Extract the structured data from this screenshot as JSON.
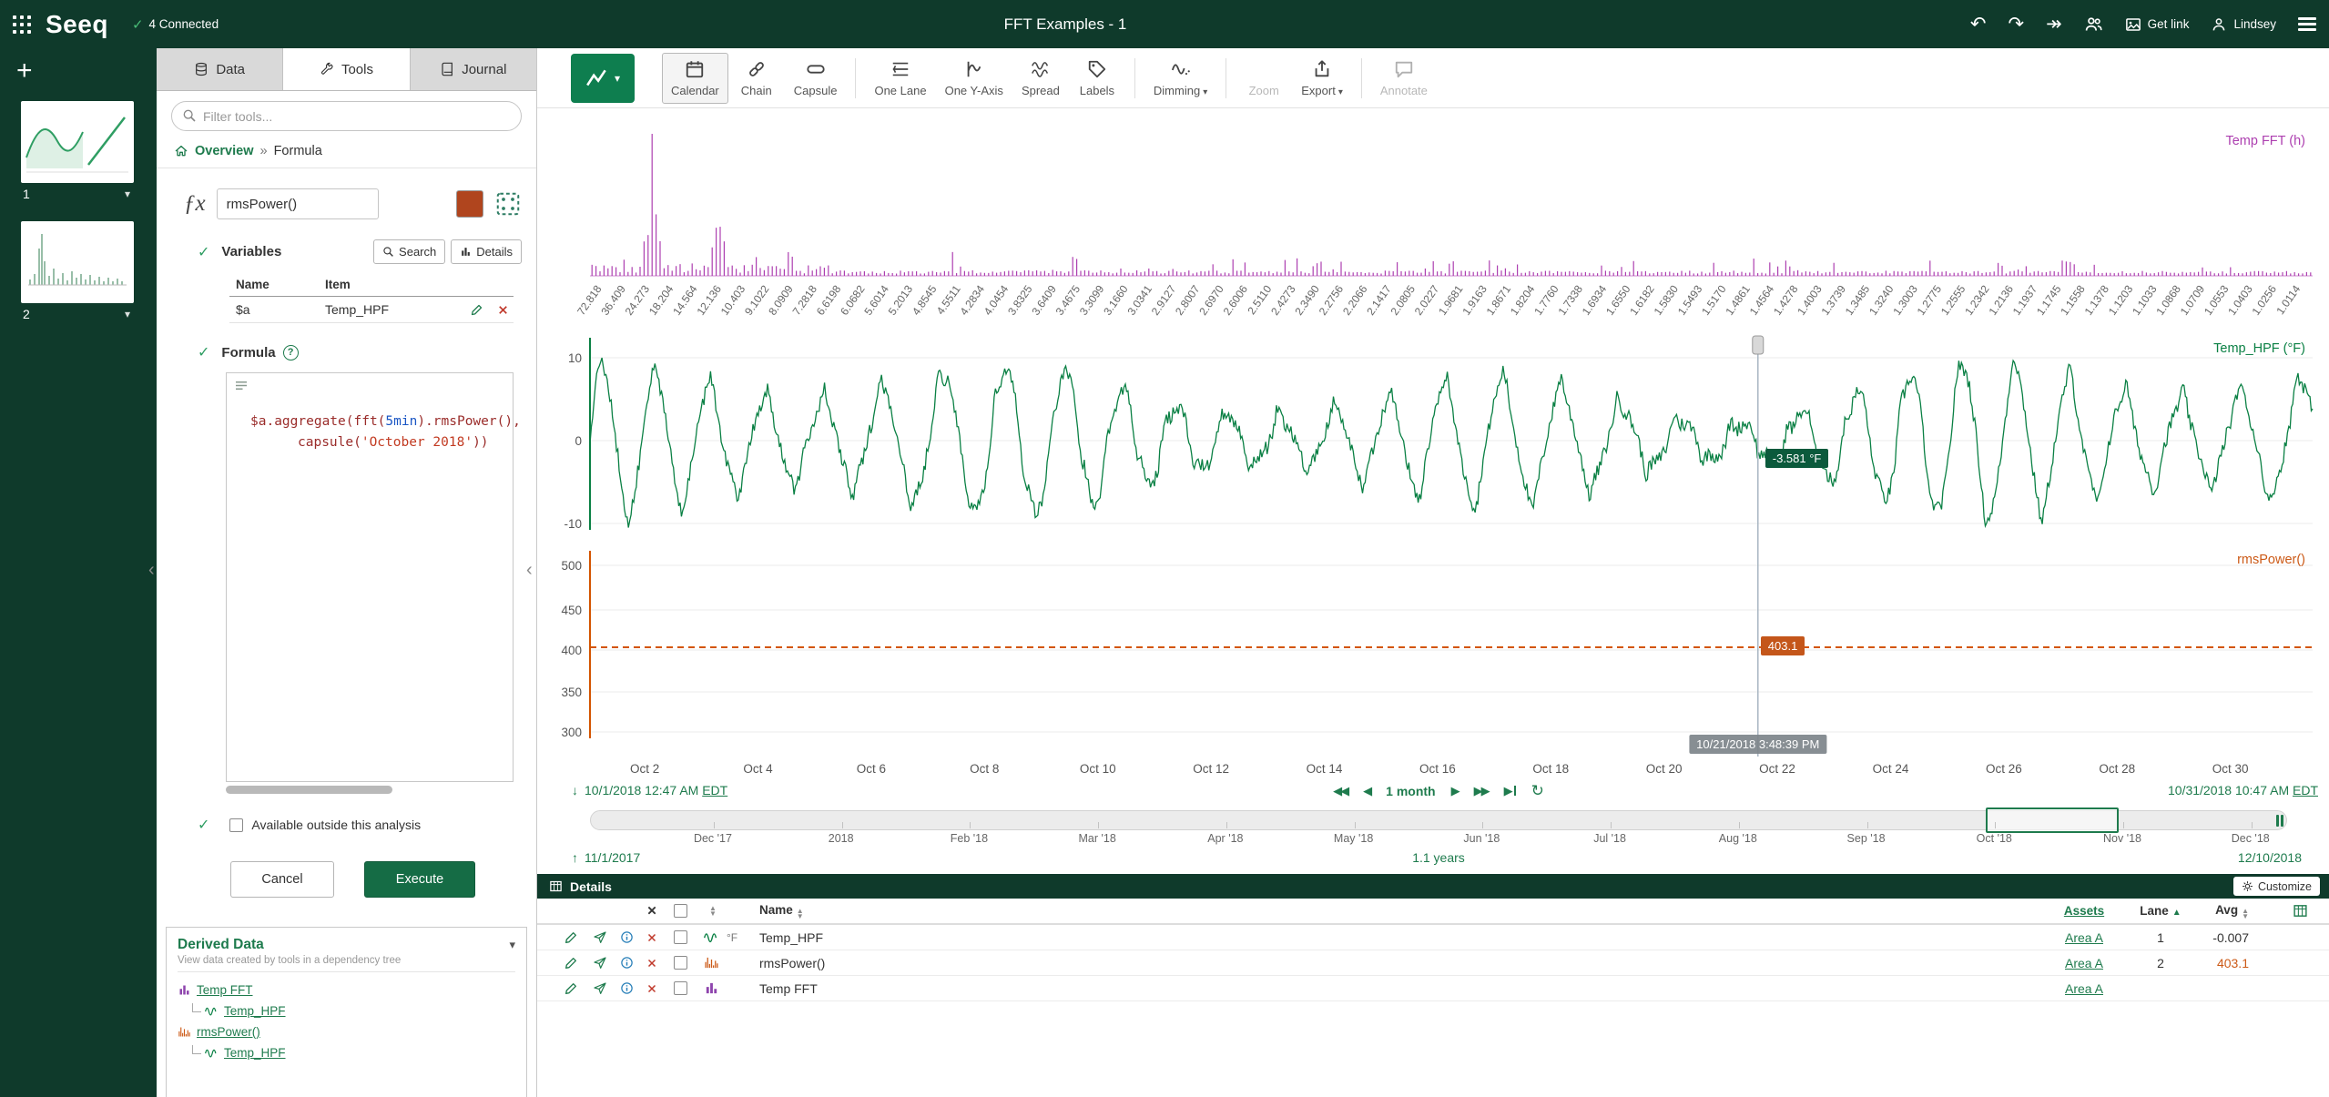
{
  "topbar": {
    "logo": "Seeq",
    "connected": "4 Connected",
    "title": "FFT Examples - 1",
    "get_link": "Get link",
    "user": "Lindsey"
  },
  "sidebar": {
    "sheets": [
      {
        "num": "1"
      },
      {
        "num": "2"
      }
    ]
  },
  "tools": {
    "tabs": [
      {
        "label": "Data"
      },
      {
        "label": "Tools"
      },
      {
        "label": "Journal"
      }
    ],
    "filter_placeholder": "Filter tools...",
    "breadcrumb_root": "Overview",
    "breadcrumb_sep": "»",
    "breadcrumb_current": "Formula",
    "formula": {
      "fx": "ƒx",
      "name": "rmsPower()",
      "swatch_color": "#b0451e",
      "variables_label": "Variables",
      "search_btn": "Search",
      "details_btn": "Details",
      "col_name": "Name",
      "col_item": "Item",
      "vars": [
        {
          "name": "$a",
          "item": "Temp_HPF"
        }
      ],
      "formula_label": "Formula",
      "help": "?",
      "code_lines": [
        [
          {
            "t": "$a.aggregate(fft(",
            "c": "k"
          },
          {
            "t": "5min",
            "c": "n"
          },
          {
            "t": ").rmsPower(),",
            "c": "k"
          }
        ],
        [
          {
            "t": "capsule(",
            "c": "k"
          },
          {
            "t": "'October 2018'",
            "c": "s"
          },
          {
            "t": "))",
            "c": "k"
          }
        ]
      ],
      "available_label": "Available outside this analysis",
      "cancel": "Cancel",
      "execute": "Execute"
    },
    "derived": {
      "title": "Derived Data",
      "subtitle": "View data created by tools in a dependency tree",
      "items": [
        {
          "label": "Temp FFT",
          "icon": "bars",
          "color": "#8e44ad",
          "child": false
        },
        {
          "label": "Temp_HPF",
          "icon": "wave",
          "color": "#0a8044",
          "child": true
        },
        {
          "label": "rmsPower()",
          "icon": "spikes",
          "color": "#cc5a17",
          "child": false
        },
        {
          "label": "Temp_HPF",
          "icon": "wave",
          "color": "#0a8044",
          "child": true
        }
      ]
    }
  },
  "toolbar": {
    "buttons": [
      {
        "label": "Calendar",
        "icon": "calendar",
        "active": true
      },
      {
        "label": "Chain",
        "icon": "chain"
      },
      {
        "label": "Capsule",
        "icon": "capsule",
        "sep_after": true
      },
      {
        "label": "One Lane",
        "icon": "lane"
      },
      {
        "label": "One Y-Axis",
        "icon": "yaxis"
      },
      {
        "label": "Spread",
        "icon": "spread"
      },
      {
        "label": "Labels",
        "icon": "tag",
        "sep_after": true
      },
      {
        "label": "Dimming",
        "icon": "dim",
        "caret": true,
        "sep_after": true
      },
      {
        "label": "Zoom",
        "icon": "zoom",
        "disabled": true
      },
      {
        "label": "Export",
        "icon": "export",
        "caret": true,
        "sep_after": true
      },
      {
        "label": "Annotate",
        "icon": "annotate",
        "disabled": true
      }
    ]
  },
  "chart": {
    "fft_label": "Temp FFT (h)",
    "hpf_label": "Temp_HPF (°F)",
    "rms_label": "rmsPower()",
    "hpf_ticks": [
      "10",
      "0",
      "-10"
    ],
    "rms_ticks": [
      "500",
      "450",
      "400",
      "350",
      "300"
    ],
    "fft_ticks": [
      "72.818",
      "36.409",
      "24.273",
      "18.204",
      "14.564",
      "12.136",
      "10.403",
      "9.1022",
      "8.0909",
      "7.2818",
      "6.6198",
      "6.0682",
      "5.6014",
      "5.2013",
      "4.8545",
      "4.5511",
      "4.2834",
      "4.0454",
      "3.8325",
      "3.6409",
      "3.4675",
      "3.3099",
      "3.1660",
      "3.0341",
      "2.9127",
      "2.8007",
      "2.6970",
      "2.6006",
      "2.5110",
      "2.4273",
      "2.3490",
      "2.2756",
      "2.2066",
      "2.1417",
      "2.0805",
      "2.0227",
      "1.9681",
      "1.9163",
      "1.8671",
      "1.8204",
      "1.7760",
      "1.7338",
      "1.6934",
      "1.6550",
      "1.6182",
      "1.5830",
      "1.5493",
      "1.5170",
      "1.4861",
      "1.4564",
      "1.4278",
      "1.4003",
      "1.3739",
      "1.3485",
      "1.3240",
      "1.3003",
      "1.2775",
      "1.2555",
      "1.2342",
      "1.2136",
      "1.1937",
      "1.1745",
      "1.1558",
      "1.1378",
      "1.1203",
      "1.1033",
      "1.0868",
      "1.0709",
      "1.0553",
      "1.0403",
      "1.0256",
      "1.0114"
    ],
    "x_ticks": [
      "Oct 2",
      "Oct 4",
      "Oct 6",
      "Oct 8",
      "Oct 10",
      "Oct 12",
      "Oct 14",
      "Oct 16",
      "Oct 18",
      "Oct 20",
      "Oct 22",
      "Oct 24",
      "Oct 26",
      "Oct 28",
      "Oct 30"
    ],
    "cursor_time": "10/21/2018 3:48:39 PM",
    "cursor_temp": "-3.581 °F",
    "cursor_rms": "403.1",
    "cursor_frac": 0.678,
    "range_start": "10/1/2018 12:47 AM",
    "range_start_tz": "EDT",
    "range_end": "10/31/2018 10:47 AM",
    "range_end_tz": "EDT",
    "step_label": "1 month",
    "timeline_ticks": [
      "Dec '17",
      "2018",
      "Feb '18",
      "Mar '18",
      "Apr '18",
      "May '18",
      "Jun '18",
      "Jul '18",
      "Aug '18",
      "Sep '18",
      "Oct '18",
      "Nov '18",
      "Dec '18"
    ],
    "timeline_start": "11/1/2017",
    "timeline_duration": "1.1 years",
    "timeline_end": "12/10/2018",
    "sel_frac": [
      0.823,
      0.901
    ],
    "colors": {
      "fft": "#ad3fb0",
      "hpf": "#0a8044",
      "rms": "#d35400"
    }
  },
  "details": {
    "title": "Details",
    "customize": "Customize",
    "x_header": "✕",
    "name_header": "Name",
    "assets_header": "Assets",
    "lane_header": "Lane",
    "avg_header": "Avg",
    "rows": [
      {
        "icon": "wave",
        "color": "#0a8044",
        "unit": "°F",
        "name": "Temp_HPF",
        "asset": "Area A",
        "lane": "1",
        "avg": "-0.007",
        "avg_color": "#333333"
      },
      {
        "icon": "spikes",
        "color": "#cc5a17",
        "unit": "",
        "name": "rmsPower()",
        "asset": "Area A",
        "lane": "2",
        "avg": "403.1",
        "avg_color": "#cc5a17"
      },
      {
        "icon": "bars",
        "color": "#8e44ad",
        "unit": "",
        "name": "Temp FFT",
        "asset": "Area A",
        "lane": "",
        "avg": "",
        "avg_color": "#333333"
      }
    ]
  },
  "chart_data": [
    {
      "type": "bar",
      "title": "Temp FFT",
      "x_unit": "period (h)",
      "x_range": [
        "72.818",
        "1.0114"
      ],
      "note": "FFT magnitude spectrum of Temp_HPF; dominant spike at 24.273 h (daily cycle), secondary cluster near 12.136 h, low-level noise elsewhere"
    },
    {
      "type": "line",
      "title": "Temp_HPF",
      "y_unit": "°F",
      "ylim": [
        -10,
        10
      ],
      "x_range": [
        "10/1/2018 12:47 AM EDT",
        "10/31/2018 10:47 AM EDT"
      ],
      "cursor": {
        "x": "10/21/2018 3:48:39 PM",
        "y": -3.581
      },
      "avg": -0.007,
      "note": "high-pass-filtered temperature oscillating roughly daily between about -10 and +10 °F"
    },
    {
      "type": "line",
      "title": "rmsPower()",
      "ylim": [
        300,
        500
      ],
      "style": "dashed",
      "values": [
        {
          "x_range": "October 2018",
          "y": 403.1
        }
      ]
    }
  ]
}
